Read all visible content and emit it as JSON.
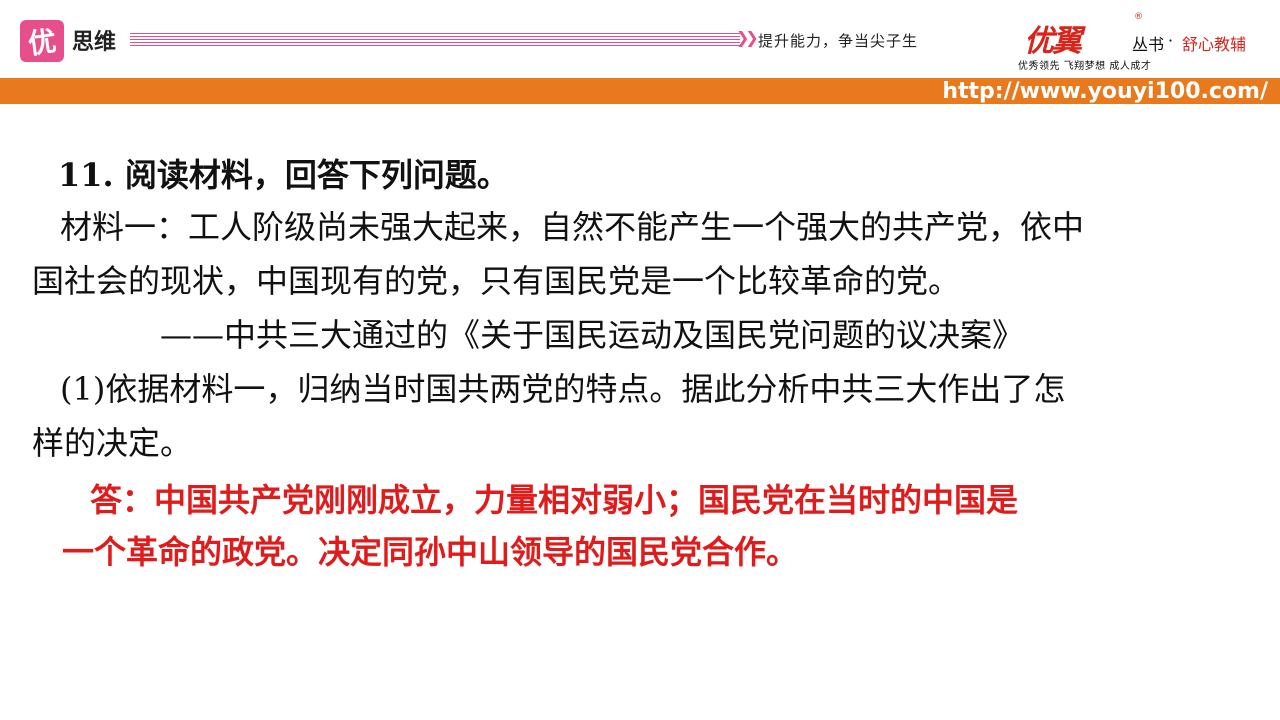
{
  "header": {
    "logo_char": "优",
    "title": "思维",
    "slogan": "提升能力，争当尖子生",
    "brand_name": "优翼",
    "reg_mark": "®",
    "series_label": "丛书",
    "series_dot": "·",
    "series_tagline": "舒心教辅",
    "brand_subtitle": "优秀领先 飞翔梦想 成人成才",
    "url": "http://www.youyi100.com/"
  },
  "content": {
    "question_title": "11. 阅读材料，回答下列问题。",
    "material_line1": "材料一：工人阶级尚未强大起来，自然不能产生一个强大的共产党，依中",
    "material_line2": "国社会的现状，中国现有的党，只有国民党是一个比较革命的党。",
    "material_source": "——中共三大通过的《关于国民运动及国民党问题的议决案》",
    "sub_question_line1": "(1)依据材料一，归纳当时国共两党的特点。据此分析中共三大作出了怎",
    "sub_question_line2": "样的决定。",
    "answer_line1": "答：中国共产党刚刚成立，力量相对弱小；国民党在当时的中国是",
    "answer_line2": "一个革命的政党。决定同孙中山领导的国民党合作。"
  },
  "colors": {
    "accent_orange": "#e8791d",
    "logo_pink": "#e64f8c",
    "answer_red": "#e01b1b",
    "brand_red": "#d9241c"
  }
}
